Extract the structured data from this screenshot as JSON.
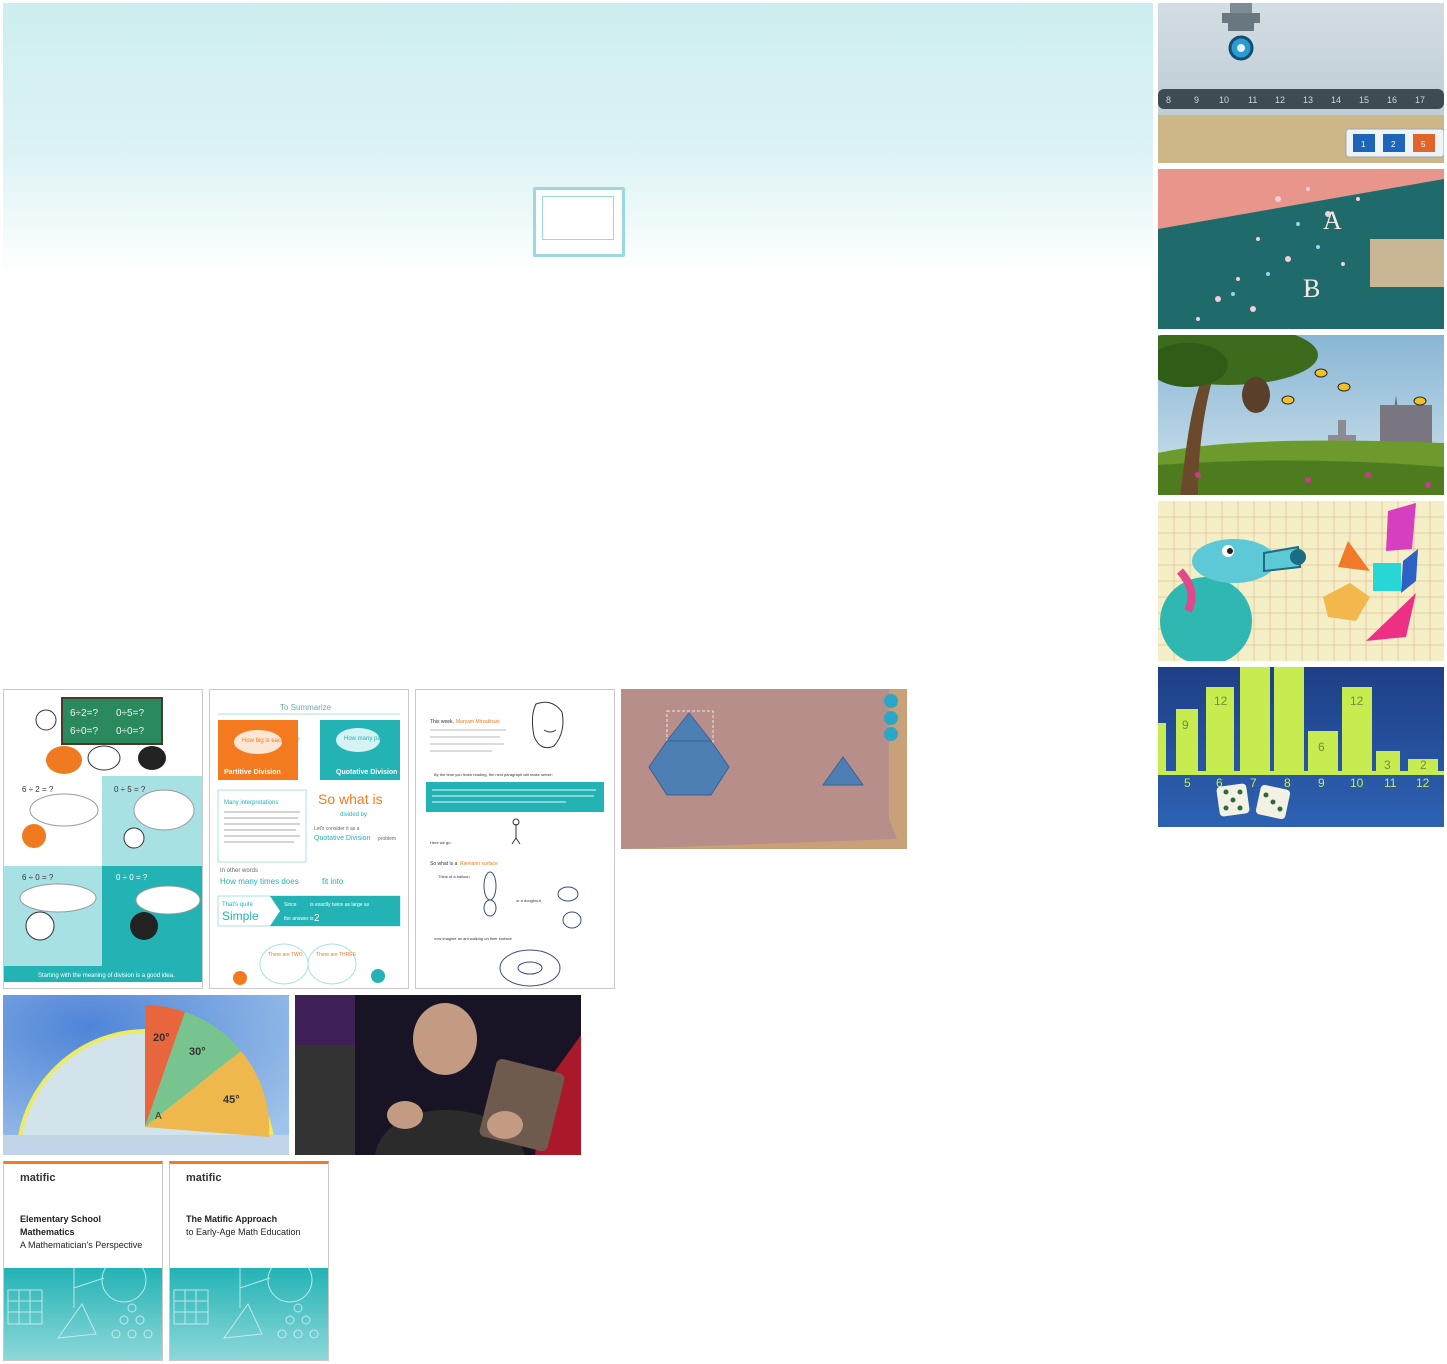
{
  "hero": {
    "slide_frame_icon": "empty-slide-frame"
  },
  "thumbs": {
    "number_line": {
      "ticks": [
        "8",
        "9",
        "10",
        "11",
        "12",
        "13",
        "14",
        "15",
        "16",
        "17"
      ],
      "btn_1": "1",
      "btn_2": "2",
      "btn_3": "5"
    },
    "stars": {
      "label_a": "A",
      "label_b": "B"
    },
    "bar_chart": {
      "x_labels": [
        "5",
        "6",
        "7",
        "8",
        "9",
        "10",
        "11",
        "12"
      ],
      "values": [
        "9",
        "12",
        "6",
        "12",
        "3",
        "2"
      ]
    }
  },
  "comic": {
    "board_1": "6÷2=?",
    "board_2": "0÷5=?",
    "board_3": "6÷0=?",
    "board_4": "0÷0=?",
    "cell_1": "6 ÷ 2 = ?",
    "cell_2": "0 ÷ 5 = ?",
    "cell_3": "6 ÷ 0 = ?",
    "cell_4": "0 ÷ 0 = ?",
    "caption": "Starting with the meaning of division is a good idea."
  },
  "summary": {
    "header": "To Summarize",
    "bubble_1": "How big is each part?",
    "bubble_2": "How many parts?",
    "partitive": "Partitive Division",
    "quotative": "Quotative Division",
    "interp_title": "Many interpretations",
    "so_what": "So what is",
    "divided_by": "divided by",
    "consider": "Let's consider it as a",
    "quotative_problem": "Quotative Division",
    "problem": "problem",
    "other_words": "In other words",
    "how_many": "How many times does",
    "fit_into": "fit into",
    "thats_quite": "That's quite",
    "simple": "Simple",
    "since": "Since",
    "twice": "is exactly twice as large as",
    "answer_is": "the answer is",
    "answer": "2",
    "there_are_two": "There are TWO",
    "there_are_three": "There are THREE",
    "in": "in"
  },
  "article": {
    "intro_1": "This week,",
    "name": "Maryam Mirzakhani",
    "intro_2": "became the first woman to be awarded the Fields medal, the highest honor bestowed upon a mathematician.",
    "by_time": "By the time you finish reading, the next paragraph will make sense:",
    "box": "Some of Mirzakhani's main contributions are in the field of Riemann surfaces. One of her contributions was determining a general formula for the number of closed geodesic curves in a Riemann surface that has a very large genus.",
    "here_we_go": "Here we go.",
    "so_what": "So what is a",
    "riemann": "Riemann surface",
    "think_balloon": "Think of a balloon",
    "or_doughnut": "or a doughnut,",
    "now_imagine": "now imagine an ant walking on their surface"
  },
  "angles": {
    "a1": "20°",
    "a2": "30°",
    "a3": "45°",
    "point": "A"
  },
  "covers": [
    {
      "brand": "matific",
      "title_1": "Elementary School",
      "title_2": "Mathematics",
      "subtitle": "A Mathematician's Perspective"
    },
    {
      "brand": "matific",
      "title_1": "The Matific Approach",
      "title_2": "",
      "subtitle": "to Early-Age Math Education"
    }
  ],
  "colors": {
    "teal": "#23b3b5",
    "orange": "#f47a1f",
    "hero_top": "#cdeef0"
  }
}
